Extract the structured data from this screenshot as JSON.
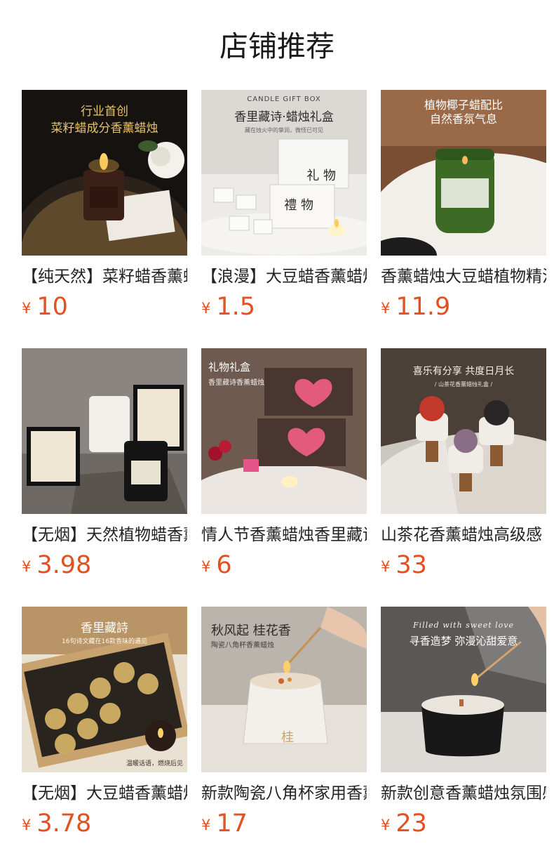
{
  "section": {
    "title": "店铺推荐"
  },
  "products": [
    {
      "name": "【纯天然】菜籽蜡香薰蜡烛",
      "price": "10",
      "currency": "¥",
      "image": {
        "lines": [
          "行业首创",
          "菜籽蜡成分香薰蜡烛"
        ],
        "palette": [
          "#1b1714",
          "#3a2c22",
          "#d8a640"
        ]
      }
    },
    {
      "name": "【浪漫】大豆蜡香薰蜡烛",
      "price": "1.5",
      "currency": "¥",
      "image": {
        "lines": [
          "CANDLE GIFT BOX",
          "香里藏诗·蜡烛礼盒",
          "藏在烛火中的挚润，微怪已可见",
          "礼 物",
          "禮 物"
        ],
        "palette": [
          "#d9d6d1",
          "#f2f1ee",
          "#2b2b2b"
        ]
      }
    },
    {
      "name": "香薰蜡烛大豆蜡植物精油",
      "price": "11.9",
      "currency": "¥",
      "image": {
        "lines": [
          "植物椰子蜡配比",
          "自然香氛气息"
        ],
        "palette": [
          "#8a5b3d",
          "#f3efe9",
          "#3f6b2a"
        ]
      }
    },
    {
      "name": "【无烟】天然植物蜡香薰",
      "price": "3.98",
      "currency": "¥",
      "image": {
        "lines": [],
        "palette": [
          "#8d8683",
          "#e9e3d6",
          "#1e1e1e"
        ]
      }
    },
    {
      "name": "情人节香薰蜡烛香里藏诗",
      "price": "6",
      "currency": "¥",
      "image": {
        "lines": [
          "礼物礼盒",
          "香里藏诗香薰蜡烛"
        ],
        "palette": [
          "#6f5a4f",
          "#e8e2dc",
          "#e0567a"
        ]
      }
    },
    {
      "name": "山茶花香薰蜡烛高级感",
      "price": "33",
      "currency": "¥",
      "image": {
        "lines": [
          "喜乐有分享 共度日月长",
          "/ 山茶花香薰蜡烛礼盒 /"
        ],
        "palette": [
          "#4a4038",
          "#d9d3cc",
          "#b3402f"
        ]
      }
    },
    {
      "name": "【无烟】大豆蜡香薰蜡烛",
      "price": "3.78",
      "currency": "¥",
      "image": {
        "lines": [
          "香里藏詩",
          "16句诗文藏在16款香味的遇见",
          "温暖话语，燃烧后见"
        ],
        "palette": [
          "#b89366",
          "#e8dcc6",
          "#2a2420"
        ]
      }
    },
    {
      "name": "新款陶瓷八角杯家用香薰",
      "price": "17",
      "currency": "¥",
      "image": {
        "lines": [
          "秋风起 桂花香",
          "陶瓷八角杯香薰蜡烛",
          "桂"
        ],
        "palette": [
          "#b9b2ab",
          "#ece7e2",
          "#3b3b3b"
        ]
      }
    },
    {
      "name": "新款创意香薰蜡烛氛围感",
      "price": "23",
      "currency": "¥",
      "image": {
        "lines": [
          "Filled with sweet love",
          "寻香造梦 弥漫沁甜爱意"
        ],
        "palette": [
          "#5a5656",
          "#dcd8d4",
          "#161616"
        ]
      }
    }
  ]
}
